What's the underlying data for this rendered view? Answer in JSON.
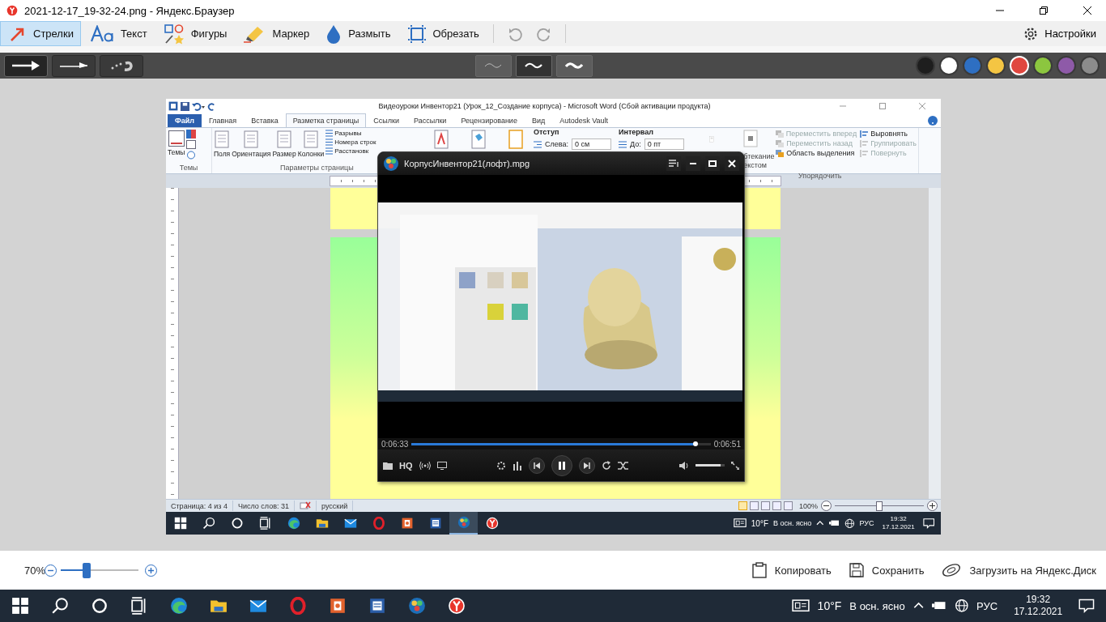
{
  "browser": {
    "title": "2021-12-17_19-32-24.png - Яндекс.Браузер"
  },
  "tools": [
    {
      "kind": "arrow",
      "label": "Стрелки",
      "selected": true
    },
    {
      "kind": "text",
      "label": "Текст",
      "selected": false
    },
    {
      "kind": "shapes",
      "label": "Фигуры",
      "selected": false
    },
    {
      "kind": "marker",
      "label": "Маркер",
      "selected": false
    },
    {
      "kind": "blur",
      "label": "Размыть",
      "selected": false
    },
    {
      "kind": "crop",
      "label": "Обрезать",
      "selected": false
    }
  ],
  "history": [
    {
      "kind": "undo",
      "disabled": true
    },
    {
      "kind": "redo",
      "disabled": true
    }
  ],
  "settings": {
    "label": "Настройки"
  },
  "arrow_styles": [
    {
      "kind": "thick",
      "selected": true
    },
    {
      "kind": "thin",
      "selected": false
    },
    {
      "kind": "dotted",
      "selected": false
    }
  ],
  "stroke_widths": [
    {
      "kind": "thin",
      "selected": false
    },
    {
      "kind": "medium",
      "selected": true
    },
    {
      "kind": "thick",
      "selected": false
    }
  ],
  "colors": [
    {
      "color": "#1e1e1e",
      "selected": false
    },
    {
      "color": "#ffffff",
      "selected": false
    },
    {
      "color": "#2e6fc2",
      "selected": false
    },
    {
      "color": "#f4c543",
      "selected": false
    },
    {
      "color": "#e0463e",
      "selected": true
    },
    {
      "color": "#8cc63f",
      "selected": false
    },
    {
      "color": "#8e5aa8",
      "selected": false
    },
    {
      "color": "#8c8c8c",
      "selected": false
    }
  ],
  "word": {
    "title": "Видеоуроки Инвентор21 (Урок_12_Создание корпуса)  -  Microsoft Word (Сбой активации продукта)",
    "file_tab": "Файл",
    "tabs": [
      {
        "label": "Главная",
        "selected": false
      },
      {
        "label": "Вставка",
        "selected": false
      },
      {
        "label": "Разметка страницы",
        "selected": true
      },
      {
        "label": "Ссылки",
        "selected": false
      },
      {
        "label": "Рассылки",
        "selected": false
      },
      {
        "label": "Рецензирование",
        "selected": false
      },
      {
        "label": "Вид",
        "selected": false
      },
      {
        "label": "Autodesk Vault",
        "selected": false
      }
    ],
    "themes": {
      "button": "Темы",
      "group": "Темы"
    },
    "page_setup": {
      "buttons": [
        "Поля",
        "Ориентация",
        "Размер",
        "Колонки"
      ],
      "small": [
        "Разрывы",
        "Номера строк",
        "Расстановк"
      ],
      "group": "Параметры страницы"
    },
    "indent": {
      "heading": "Отступ",
      "label": "Слева:",
      "value": "0 см"
    },
    "spacing": {
      "heading": "Интервал",
      "label": "До:",
      "value": "0 пт"
    },
    "arrange": {
      "wrap": [
        "бтекание",
        "екстом"
      ],
      "group": "Упорядочить",
      "items": [
        {
          "label": "Переместить вперед",
          "disabled": true
        },
        {
          "label": "Переместить назад",
          "disabled": true
        },
        {
          "label": "Область выделения",
          "disabled": false
        },
        {
          "label": "Выровнять",
          "disabled": false
        },
        {
          "label": "Группировать",
          "disabled": true
        },
        {
          "label": "Повернуть",
          "disabled": true
        }
      ]
    },
    "status": {
      "page": "Страница: 4 из 4",
      "words": "Число слов: 31",
      "language": "русский",
      "zoom": "100%",
      "level": 0.5,
      "views": [
        {
          "selected": true
        },
        {
          "selected": false
        },
        {
          "selected": false
        },
        {
          "selected": false
        },
        {
          "selected": false
        }
      ]
    },
    "taskbar": {
      "apps": [
        {
          "kind": "start",
          "active": false
        },
        {
          "kind": "search",
          "active": false
        },
        {
          "kind": "cortana",
          "active": false
        },
        {
          "kind": "taskview",
          "active": false
        },
        {
          "kind": "edge",
          "active": false
        },
        {
          "kind": "explorer",
          "active": false
        },
        {
          "kind": "mail",
          "active": false
        },
        {
          "kind": "opera",
          "active": false
        },
        {
          "kind": "ppt",
          "active": false
        },
        {
          "kind": "word",
          "active": false
        },
        {
          "kind": "player",
          "active": true
        },
        {
          "kind": "yandex",
          "active": false
        }
      ],
      "weather": "10°F",
      "forecast": "В осн. ясно",
      "language": "РУС",
      "time": "19:32",
      "date": "17.12.2021"
    }
  },
  "player": {
    "title": "КорпусИнвентор21(лофт).mpg",
    "elapsed": "0:06:33",
    "duration": "0:06:51",
    "level": 0.95,
    "quality": "HQ",
    "playing": true,
    "volume": {
      "level": 0.85
    }
  },
  "zoom": {
    "label": "70%",
    "level": 0.33
  },
  "actions": [
    {
      "kind": "copy",
      "label": "Копировать"
    },
    {
      "kind": "save",
      "label": "Сохранить"
    },
    {
      "kind": "disk",
      "label": "Загрузить на Яндекс.Диск"
    }
  ],
  "taskbar": {
    "apps": [
      {
        "kind": "start",
        "active": false
      },
      {
        "kind": "search",
        "active": false
      },
      {
        "kind": "cortana",
        "active": false
      },
      {
        "kind": "taskview",
        "active": false
      },
      {
        "kind": "edge",
        "active": false
      },
      {
        "kind": "explorer",
        "active": false
      },
      {
        "kind": "mail",
        "active": false
      },
      {
        "kind": "opera",
        "active": false
      },
      {
        "kind": "ppt",
        "active": false
      },
      {
        "kind": "word",
        "active": false
      },
      {
        "kind": "player",
        "active": false
      },
      {
        "kind": "yandex",
        "active": false
      }
    ],
    "weather": "10°F",
    "forecast": "В осн. ясно",
    "language": "РУС",
    "time": "19:32",
    "date": "17.12.2021"
  }
}
